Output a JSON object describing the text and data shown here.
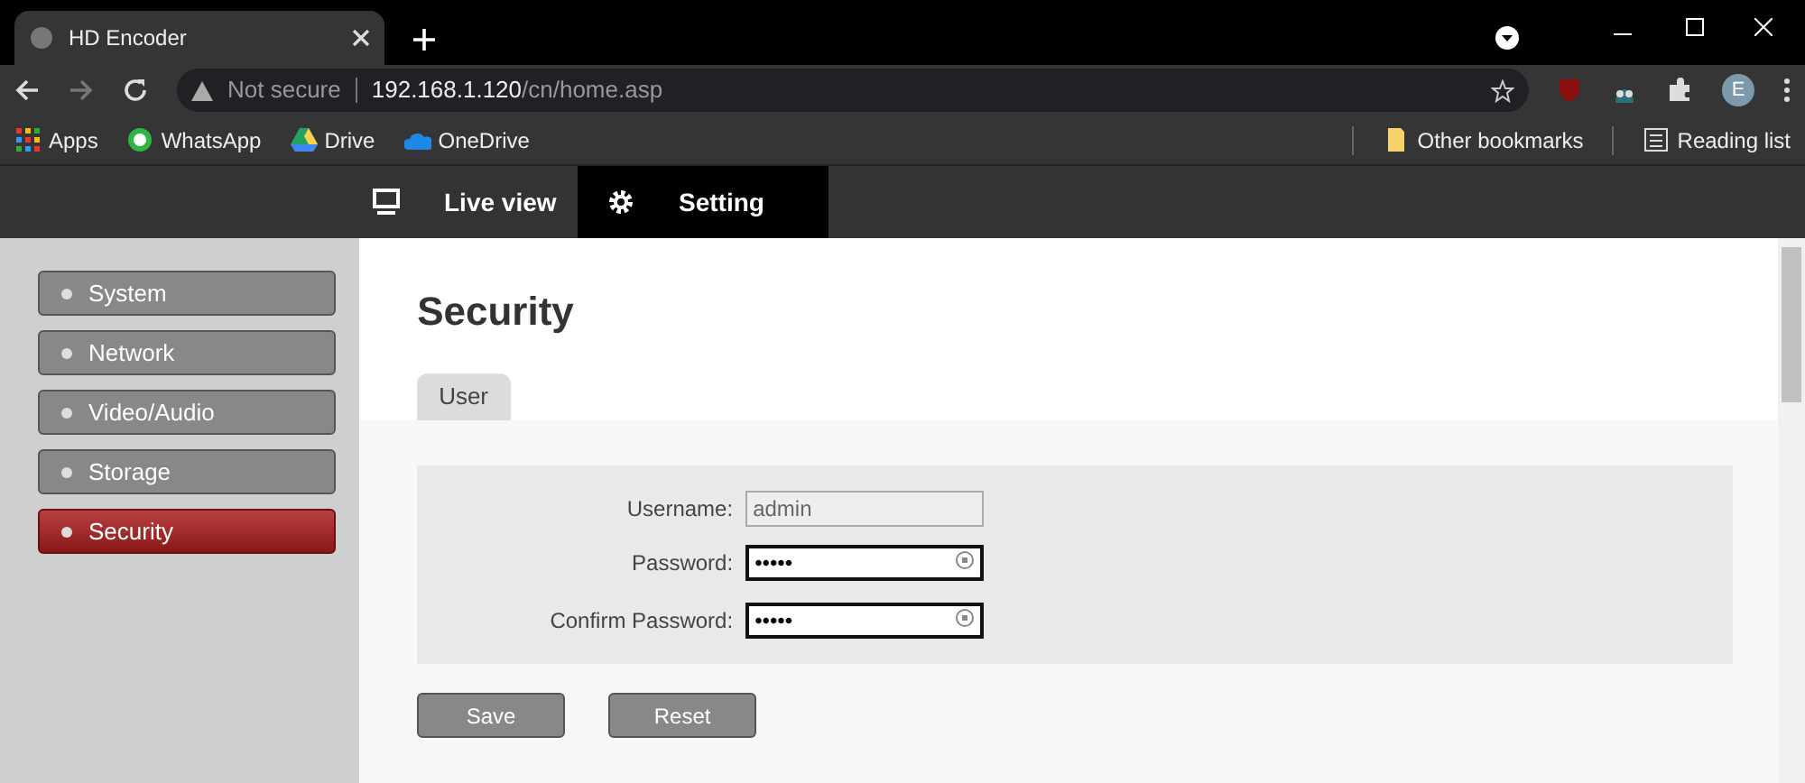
{
  "browser": {
    "tab_title": "HD Encoder",
    "security_label": "Not secure",
    "url_host": "192.168.1.120",
    "url_path": "/cn/home.asp",
    "profile_initial": "E",
    "bookmarks": [
      {
        "label": "Apps",
        "kind": "apps"
      },
      {
        "label": "WhatsApp",
        "kind": "whatsapp"
      },
      {
        "label": "Drive",
        "kind": "drive"
      },
      {
        "label": "OneDrive",
        "kind": "onedrive"
      }
    ],
    "bookmarks_right": [
      {
        "label": "Other bookmarks",
        "kind": "folder"
      },
      {
        "label": "Reading list",
        "kind": "reading"
      }
    ]
  },
  "nav": [
    {
      "label": "Live view",
      "kind": "monitor",
      "selected": false
    },
    {
      "label": "Setting",
      "kind": "gear",
      "selected": true
    }
  ],
  "sidebar": {
    "items": [
      {
        "label": "System",
        "selected": false
      },
      {
        "label": "Network",
        "selected": false
      },
      {
        "label": "Video/Audio",
        "selected": false
      },
      {
        "label": "Storage",
        "selected": false
      },
      {
        "label": "Security",
        "selected": true
      }
    ]
  },
  "page_title": "Security",
  "tabs": [
    {
      "label": "User",
      "selected": true
    }
  ],
  "form": {
    "fields": [
      {
        "label": "Username:",
        "value": "admin",
        "kind": "text",
        "disabled": true
      },
      {
        "label": "Password:",
        "value": "•••••",
        "kind": "password",
        "disabled": false
      },
      {
        "label": "Confirm Password:",
        "value": "•••••",
        "kind": "password",
        "disabled": false
      }
    ]
  },
  "buttons": [
    "Save",
    "Reset"
  ]
}
